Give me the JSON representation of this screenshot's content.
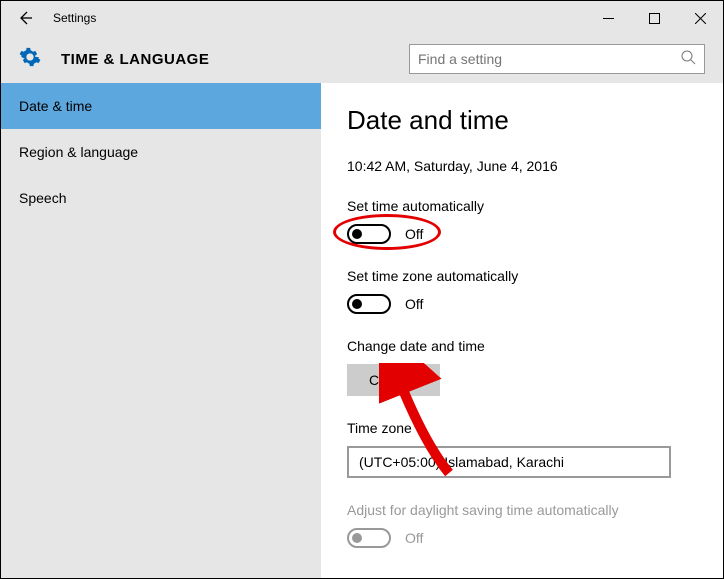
{
  "window": {
    "title": "Settings"
  },
  "header": {
    "title": "TIME & LANGUAGE",
    "search_placeholder": "Find a setting"
  },
  "sidebar": {
    "items": [
      {
        "label": "Date & time",
        "active": true
      },
      {
        "label": "Region & language",
        "active": false
      },
      {
        "label": "Speech",
        "active": false
      }
    ]
  },
  "main": {
    "heading": "Date and time",
    "current": "10:42 AM, Saturday, June 4, 2016",
    "auto_time": {
      "label": "Set time automatically",
      "state": "Off"
    },
    "auto_tz": {
      "label": "Set time zone automatically",
      "state": "Off"
    },
    "change": {
      "label": "Change date and time",
      "button": "Change"
    },
    "tz": {
      "label": "Time zone",
      "value": "(UTC+05:00) Islamabad, Karachi"
    },
    "dst": {
      "label": "Adjust for daylight saving time automatically",
      "state": "Off"
    }
  },
  "annotation": {
    "color": "#e30000"
  }
}
